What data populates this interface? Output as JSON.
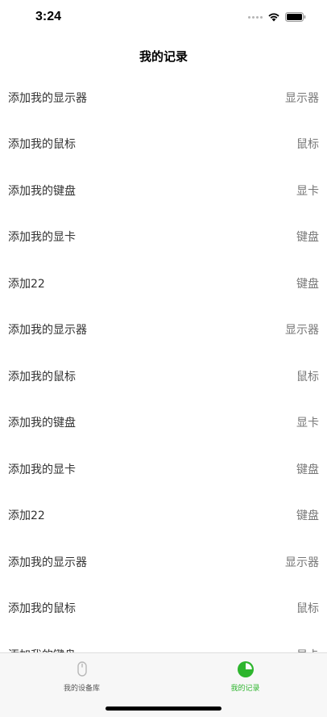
{
  "status": {
    "time": "3:24"
  },
  "nav": {
    "title": "我的记录"
  },
  "records": [
    {
      "title": "添加我的显示器",
      "category": "显示器"
    },
    {
      "title": "添加我的鼠标",
      "category": "鼠标"
    },
    {
      "title": "添加我的键盘",
      "category": "显卡"
    },
    {
      "title": "添加我的显卡",
      "category": "键盘"
    },
    {
      "title": "添加22",
      "category": "键盘"
    },
    {
      "title": "添加我的显示器",
      "category": "显示器"
    },
    {
      "title": "添加我的鼠标",
      "category": "鼠标"
    },
    {
      "title": "添加我的键盘",
      "category": "显卡"
    },
    {
      "title": "添加我的显卡",
      "category": "键盘"
    },
    {
      "title": "添加22",
      "category": "键盘"
    },
    {
      "title": "添加我的显示器",
      "category": "显示器"
    },
    {
      "title": "添加我的鼠标",
      "category": "鼠标"
    },
    {
      "title": "添加我的键盘",
      "category": "显卡"
    }
  ],
  "tabs": [
    {
      "label": "我的设备库",
      "icon": "mouse-icon",
      "active": false
    },
    {
      "label": "我的记录",
      "icon": "pie-chart-icon",
      "active": true
    }
  ],
  "colors": {
    "accent": "#2db52d",
    "inactive": "#555555",
    "tabbar_bg": "#f7f7f7"
  }
}
